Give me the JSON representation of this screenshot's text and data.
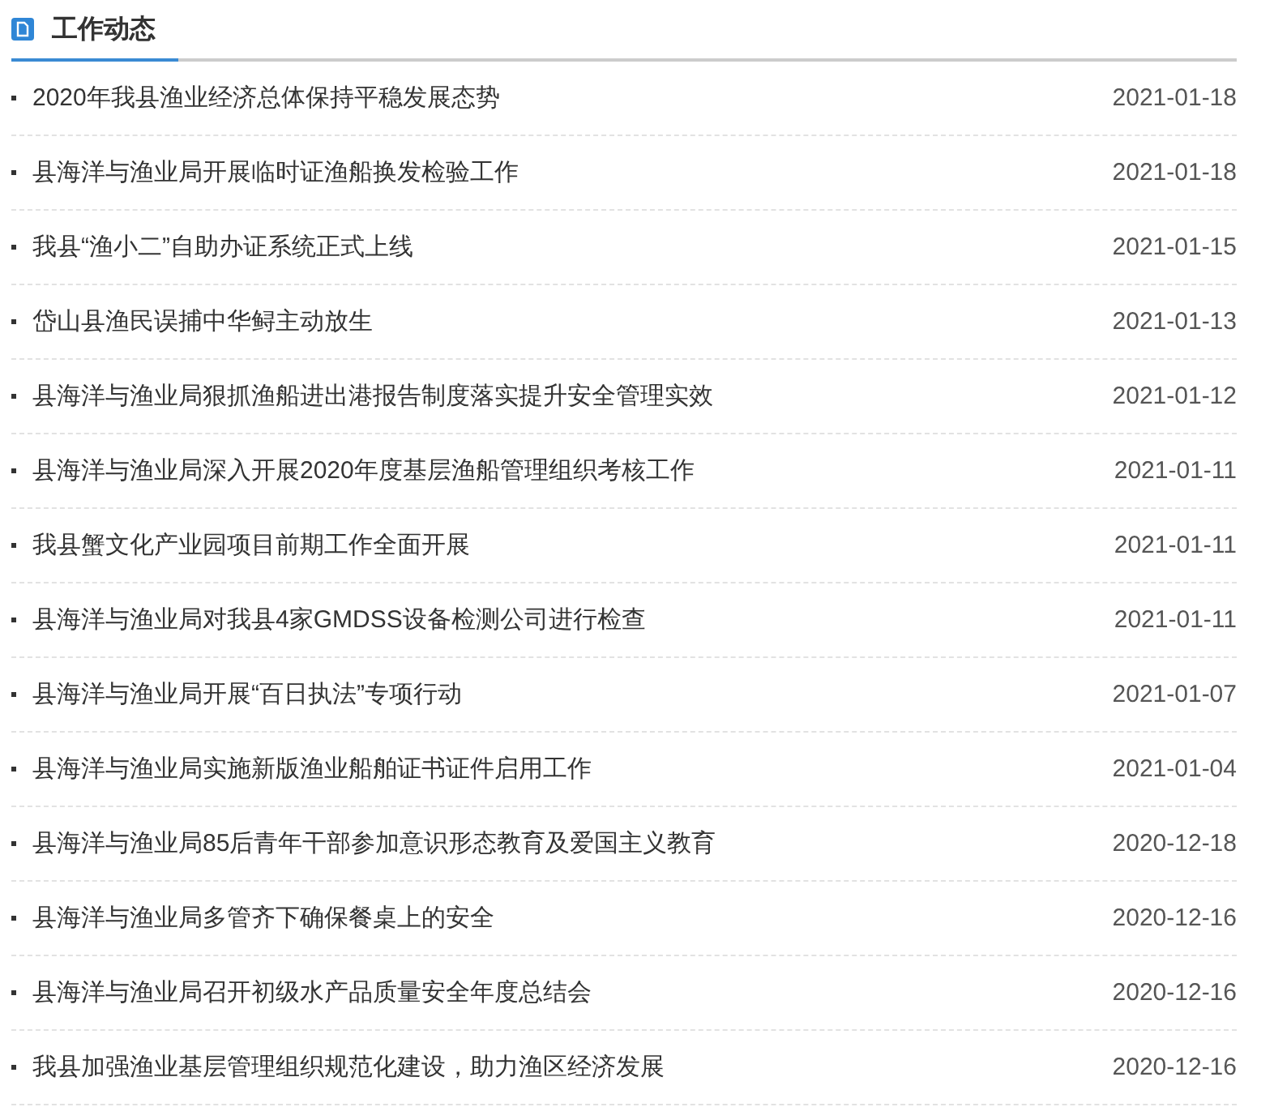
{
  "section": {
    "title": "工作动态"
  },
  "news": [
    {
      "title": "2020年我县渔业经济总体保持平稳发展态势",
      "date": "2021-01-18"
    },
    {
      "title": "县海洋与渔业局开展临时证渔船换发检验工作",
      "date": "2021-01-18"
    },
    {
      "title": "我县“渔小二”自助办证系统正式上线",
      "date": "2021-01-15"
    },
    {
      "title": "岱山县渔民误捕中华鲟主动放生",
      "date": "2021-01-13"
    },
    {
      "title": "县海洋与渔业局狠抓渔船进出港报告制度落实提升安全管理实效",
      "date": "2021-01-12"
    },
    {
      "title": "县海洋与渔业局深入开展2020年度基层渔船管理组织考核工作",
      "date": "2021-01-11"
    },
    {
      "title": "我县蟹文化产业园项目前期工作全面开展",
      "date": "2021-01-11"
    },
    {
      "title": "县海洋与渔业局对我县4家GMDSS设备检测公司进行检查",
      "date": "2021-01-11"
    },
    {
      "title": "县海洋与渔业局开展“百日执法”专项行动",
      "date": "2021-01-07"
    },
    {
      "title": "县海洋与渔业局实施新版渔业船舶证书证件启用工作",
      "date": "2021-01-04"
    },
    {
      "title": "县海洋与渔业局85后青年干部参加意识形态教育及爱国主义教育",
      "date": "2020-12-18"
    },
    {
      "title": "县海洋与渔业局多管齐下确保餐桌上的安全",
      "date": "2020-12-16"
    },
    {
      "title": "县海洋与渔业局召开初级水产品质量安全年度总结会",
      "date": "2020-12-16"
    },
    {
      "title": "我县加强渔业基层管理组织规范化建设，助力渔区经济发展",
      "date": "2020-12-16"
    }
  ]
}
